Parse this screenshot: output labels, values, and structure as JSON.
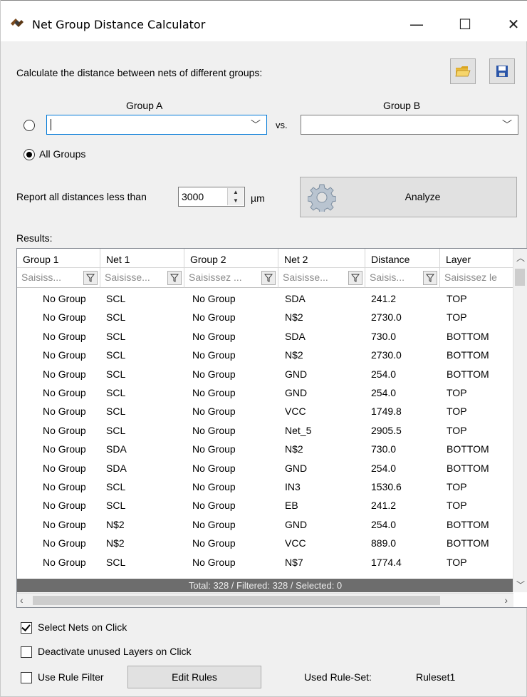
{
  "window": {
    "title": "Net Group Distance Calculator",
    "minimize_glyph": "—",
    "maximize_glyph": "☐",
    "close_glyph": "✕",
    "app_icon": "wrench-screwdriver-icon"
  },
  "toolbar": {
    "description": "Calculate the distance between nets of different groups:",
    "open_icon": "folder-open-icon",
    "save_icon": "floppy-save-icon"
  },
  "groups": {
    "group_a_label": "Group A",
    "group_b_label": "Group B",
    "group_a_value": "",
    "group_b_value": "",
    "vs_label": "vs.",
    "all_groups_label": "All Groups",
    "selected_mode": "All Groups"
  },
  "threshold": {
    "prefix": "Report all distances less than",
    "value": "3000",
    "unit": "µm"
  },
  "analyze": {
    "label": "Analyze",
    "icon": "gear-icon"
  },
  "results": {
    "label": "Results:",
    "columns": [
      "Group 1",
      "Net 1",
      "Group 2",
      "Net 2",
      "Distance",
      "Layer"
    ],
    "filter_placeholders": [
      "Saisiss...",
      "Saisisse...",
      "Saisissez ...",
      "Saisisse...",
      "Saisis...",
      "Saisissez le"
    ],
    "rows": [
      [
        "No Group",
        "SCL",
        "No Group",
        "SDA",
        "241.2",
        "TOP"
      ],
      [
        "No Group",
        "SCL",
        "No Group",
        "N$2",
        "2730.0",
        "TOP"
      ],
      [
        "No Group",
        "SCL",
        "No Group",
        "SDA",
        "730.0",
        "BOTTOM"
      ],
      [
        "No Group",
        "SCL",
        "No Group",
        "N$2",
        "2730.0",
        "BOTTOM"
      ],
      [
        "No Group",
        "SCL",
        "No Group",
        "GND",
        "254.0",
        "BOTTOM"
      ],
      [
        "No Group",
        "SCL",
        "No Group",
        "GND",
        "254.0",
        "TOP"
      ],
      [
        "No Group",
        "SCL",
        "No Group",
        "VCC",
        "1749.8",
        "TOP"
      ],
      [
        "No Group",
        "SCL",
        "No Group",
        "Net_5",
        "2905.5",
        "TOP"
      ],
      [
        "No Group",
        "SDA",
        "No Group",
        "N$2",
        "730.0",
        "BOTTOM"
      ],
      [
        "No Group",
        "SDA",
        "No Group",
        "GND",
        "254.0",
        "BOTTOM"
      ],
      [
        "No Group",
        "SCL",
        "No Group",
        "IN3",
        "1530.6",
        "TOP"
      ],
      [
        "No Group",
        "SCL",
        "No Group",
        "EB",
        "241.2",
        "TOP"
      ],
      [
        "No Group",
        "N$2",
        "No Group",
        "GND",
        "254.0",
        "BOTTOM"
      ],
      [
        "No Group",
        "N$2",
        "No Group",
        "VCC",
        "889.0",
        "BOTTOM"
      ],
      [
        "No Group",
        "SCL",
        "No Group",
        "N$7",
        "1774.4",
        "TOP"
      ]
    ],
    "status": "Total: 328 / Filtered: 328 / Selected: 0"
  },
  "options": {
    "select_nets_label": "Select Nets on Click",
    "select_nets_checked": true,
    "deactivate_layers_label": "Deactivate unused Layers on Click",
    "deactivate_layers_checked": false,
    "use_rule_filter_label": "Use Rule Filter",
    "use_rule_filter_checked": false,
    "edit_rules_label": "Edit Rules",
    "used_ruleset_label": "Used Rule-Set:",
    "used_ruleset_value": "Ruleset1"
  }
}
